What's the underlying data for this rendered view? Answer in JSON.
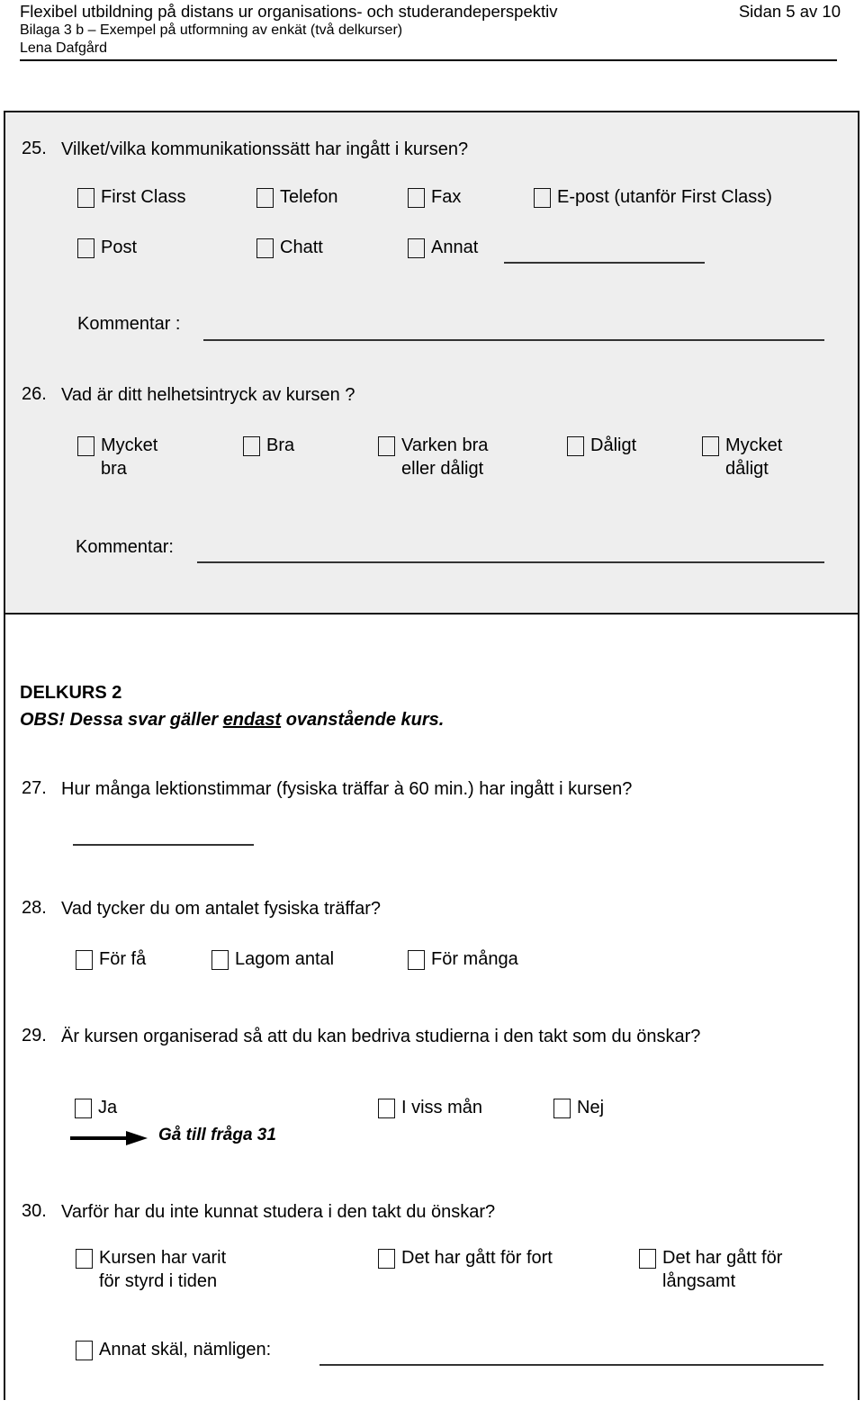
{
  "header": {
    "line1_left": "Flexibel utbildning på distans ur organisations- och studerandeperspektiv",
    "line1_right": "Sidan 5 av 10",
    "line2": "Bilaga 3 b – Exempel på utformning av enkät (två delkurser)",
    "line3": "Lena Dafgård"
  },
  "q25": {
    "number": "25.",
    "text": "Vilket/vilka kommunikationssätt har ingått i kursen?",
    "options": [
      {
        "label": "First Class"
      },
      {
        "label": "Telefon"
      },
      {
        "label": "Fax"
      },
      {
        "label": "E-post (utanför First Class)"
      },
      {
        "label": "Post"
      },
      {
        "label": "Chatt"
      },
      {
        "label": "Annat"
      }
    ],
    "comment_label": "Kommentar :"
  },
  "q26": {
    "number": "26.",
    "text": "Vad är ditt helhetsintryck av kursen ?",
    "options": [
      {
        "label": "Mycket",
        "sub": "bra"
      },
      {
        "label": "Bra",
        "sub": ""
      },
      {
        "label": "Varken bra",
        "sub": "eller dåligt"
      },
      {
        "label": "Dåligt",
        "sub": ""
      },
      {
        "label": "Mycket",
        "sub": "dåligt"
      }
    ],
    "comment_label": "Kommentar:"
  },
  "delkurs": {
    "title": "DELKURS 2",
    "note_before": "OBS! Dessa svar gäller ",
    "note_underlined": "endast",
    "note_after": " ovanstående kurs."
  },
  "q27": {
    "number": "27.",
    "text": "Hur många lektionstimmar (fysiska träffar à 60 min.) har ingått i kursen?"
  },
  "q28": {
    "number": "28.",
    "text": "Vad tycker du om antalet fysiska träffar?",
    "options": [
      {
        "label": "För få"
      },
      {
        "label": "Lagom antal"
      },
      {
        "label": "För många"
      }
    ]
  },
  "q29": {
    "number": "29.",
    "text": "Är kursen organiserad så att du kan bedriva studierna i den takt som du önskar?",
    "options": [
      {
        "label": "Ja"
      },
      {
        "label": "I viss mån"
      },
      {
        "label": "Nej"
      }
    ],
    "goto_note": "Gå till fråga 31"
  },
  "q30": {
    "number": "30.",
    "text": "Varför har du inte kunnat studera i den takt du önskar?",
    "options": [
      {
        "label": "Kursen har varit",
        "sub": "för styrd i tiden"
      },
      {
        "label": "Det har gått för fort",
        "sub": ""
      },
      {
        "label": "Det har gått för",
        "sub": "långsamt"
      },
      {
        "label": "Annat skäl, nämligen:",
        "sub": ""
      }
    ]
  }
}
